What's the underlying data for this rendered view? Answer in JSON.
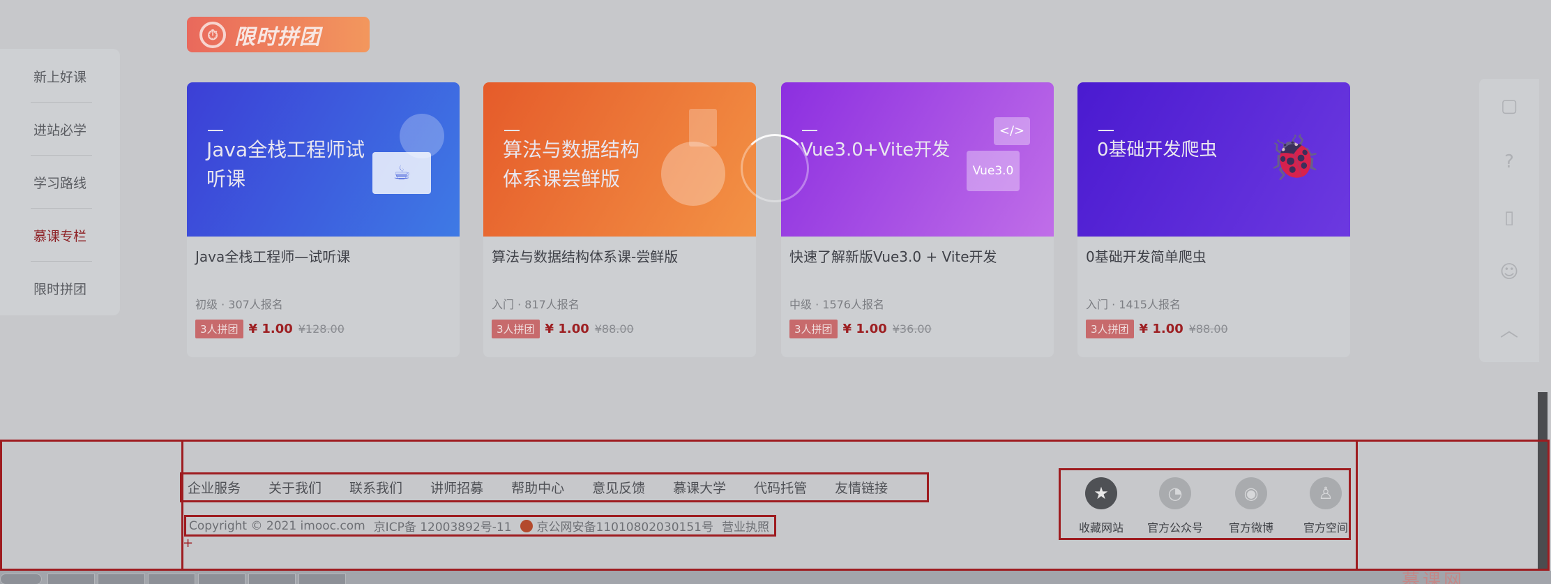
{
  "banner": {
    "title": "限时拼团"
  },
  "sidebar": {
    "items": [
      {
        "label": "新上好课"
      },
      {
        "label": "进站必学"
      },
      {
        "label": "学习路线"
      },
      {
        "label": "慕课专栏",
        "active": true
      },
      {
        "label": "限时拼团"
      }
    ]
  },
  "cards": [
    {
      "thumb_title": "Java全栈工程师试听课",
      "title": "Java全栈工程师—试听课",
      "meta": "初级 · 307人报名",
      "badge": "3人拼团",
      "price": "¥ 1.00",
      "old_price": "¥128.00",
      "color_from": "#3c3fd6",
      "color_to": "#3e7ae5"
    },
    {
      "thumb_title": "算法与数据结构体系课尝鲜版",
      "title": "算法与数据结构体系课-尝鲜版",
      "meta": "入门 · 817人报名",
      "badge": "3人拼团",
      "price": "¥ 1.00",
      "old_price": "¥88.00",
      "color_from": "#e55b2a",
      "color_to": "#f39245"
    },
    {
      "thumb_title": "Vue3.0+Vite开发",
      "title": "快速了解新版Vue3.0 + Vite开发",
      "meta": "中级 · 1576人报名",
      "badge": "3人拼团",
      "price": "¥ 1.00",
      "old_price": "¥36.00",
      "color_from": "#8c2fe0",
      "color_to": "#c06ee8",
      "icon_text": "Vue3.0"
    },
    {
      "thumb_title": "0基础开发爬虫",
      "title": "0基础开发简单爬虫",
      "meta": "入门 · 1415人报名",
      "badge": "3人拼团",
      "price": "¥ 1.00",
      "old_price": "¥88.00",
      "color_from": "#4a1ad0",
      "color_to": "#6c39e0"
    }
  ],
  "footer": {
    "links": [
      "企业服务",
      "关于我们",
      "联系我们",
      "讲师招募",
      "帮助中心",
      "意见反馈",
      "慕课大学",
      "代码托管",
      "友情链接"
    ],
    "copyright": "Copyright © 2021 imooc.com",
    "icp": "京ICP备 12003892号-11",
    "police": "京公网安备11010802030151号",
    "license": "营业执照",
    "social": [
      {
        "label": "收藏网站",
        "icon": "star-icon"
      },
      {
        "label": "官方公众号",
        "icon": "wechat-icon"
      },
      {
        "label": "官方微博",
        "icon": "weibo-icon"
      },
      {
        "label": "官方空间",
        "icon": "qq-icon"
      }
    ]
  },
  "taskbar": {
    "watermark": "慕课网"
  }
}
